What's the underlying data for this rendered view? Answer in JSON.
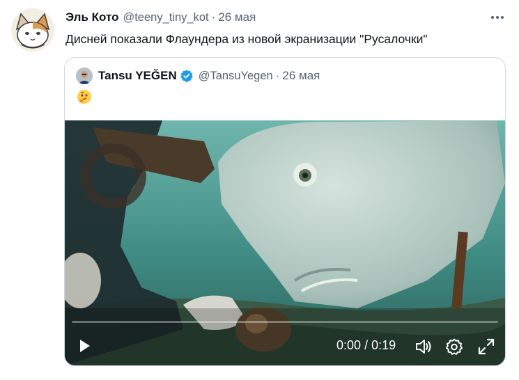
{
  "tweet": {
    "author_name": "Эль Кото",
    "handle": "@teeny_tiny_kot",
    "separator": "·",
    "date": "26 мая",
    "text": "Дисней показали Флаундера из новой экранизации \"Русалочки\"",
    "more_icon": "more-horizontal-icon"
  },
  "quoted_tweet": {
    "author_name": "Tansu YEĞEN",
    "verified": true,
    "handle": "@TansuYegen",
    "separator": "·",
    "date": "26 мая",
    "text_emoji": "🤔",
    "media": {
      "type": "video",
      "time_current": "0:00",
      "time_separator": "/",
      "time_total": "0:19",
      "progress": 0,
      "controls": [
        "play-icon",
        "volume-icon",
        "settings-gear-icon",
        "fullscreen-icon"
      ]
    }
  },
  "colors": {
    "text_primary": "#0f1419",
    "text_secondary": "#536471",
    "border": "#cfd9de",
    "verified_blue": "#1d9bf0",
    "water": "#3f8c85"
  }
}
